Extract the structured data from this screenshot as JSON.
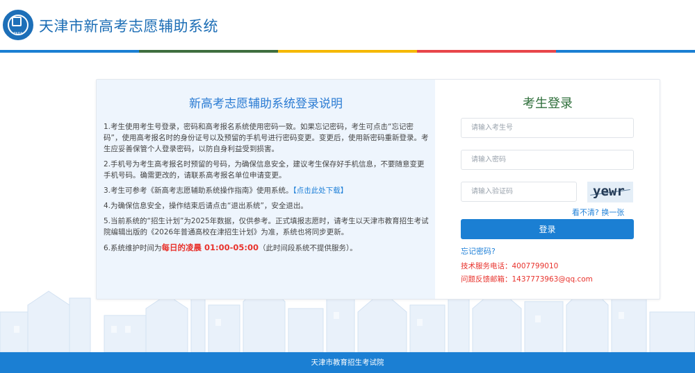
{
  "header": {
    "logo_text": "TARA",
    "title": "天津市新高考志愿辅助系统"
  },
  "colors": {
    "bar": [
      "#1b7fd3",
      "#3f6e3f",
      "#f5b800",
      "#e8464a",
      "#1b7fd3"
    ]
  },
  "info": {
    "title": "新高考志愿辅助系统登录说明",
    "item1": "1.考生使用考生号登录，密码和高考报名系统使用密码一致。如果忘记密码，考生可点击“忘记密码”，使用高考报名时的身份证号以及预留的手机号进行密码变更。变更后，使用新密码重新登录。考生应妥善保管个人登录密码，以防自身利益受到损害。",
    "item2": "2.手机号为考生高考报名时预留的号码，为确保信息安全，建议考生保存好手机信息，不要随意变更手机号码。确需更改的，请联系高考报名单位申请变更。",
    "item3_prefix": "3.考生可参考《新高考志愿辅助系统操作指南》使用系统。",
    "item3_link": "【点击此处下载】",
    "item4": "4.为确保信息安全，操作结束后请点击“退出系统”，安全退出。",
    "item5": "5.当前系统的“招生计划”为2025年数据，仅供参考。正式填报志愿时，请考生以天津市教育招生考试院编辑出版的《2026年普通高校在津招生计划》为准，系统也将同步更新。",
    "item6_prefix": "6.系统维护时间为",
    "item6_highlight": "每日的凌晨 01:00-05:00",
    "item6_suffix": "（此时间段系统不提供服务）。"
  },
  "login": {
    "title": "考生登录",
    "username_placeholder": "请输入考生号",
    "password_placeholder": "请输入密码",
    "captcha_placeholder": "请输入验证码",
    "captcha_text": "yewr",
    "refresh_label": "看不清? 换一张",
    "submit_label": "登录",
    "forgot_label": "忘记密码?",
    "phone": "技术服务电话：4007799010",
    "email": "问题反馈邮箱：1437773963@qq.com"
  },
  "footer": {
    "text": "天津市教育招生考试院"
  }
}
